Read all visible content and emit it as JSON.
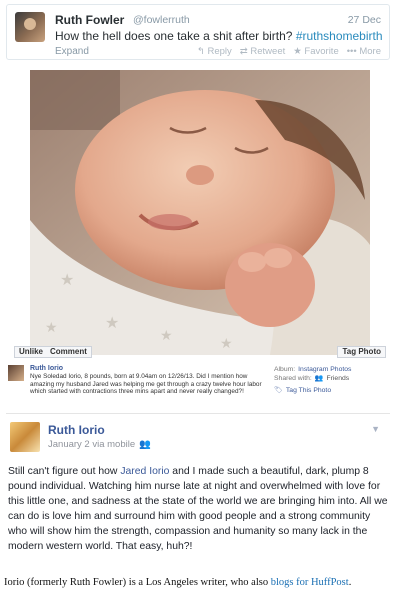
{
  "tweet": {
    "name": "Ruth Fowler",
    "handle": "@fowlerruth",
    "date": "27 Dec",
    "text": "How the hell does one take a shit after birth? ",
    "hashtag": "#ruthshomebirth",
    "expand": "Expand",
    "actions": {
      "reply": "↰ Reply",
      "retweet": "⇄ Retweet",
      "favorite": "★ Favorite",
      "more": "••• More"
    }
  },
  "photo_post": {
    "buttons": {
      "unlike": "Unlike",
      "comment": "Comment",
      "tag": "Tag Photo"
    },
    "author": "Ruth Iorio",
    "caption": "Nye Soledad Iorio, 8 pounds, born at 9.04am on 12/26/13. Did I mention how amazing my husband Jared was helping me get through a crazy twelve hour labor which started with contractions three mins apart and never really changed?!",
    "album_label": "Album:",
    "album": "Instagram Photos",
    "shared_label": "Shared with:",
    "shared_with": "Friends",
    "tag_link": "Tag This Photo"
  },
  "status_post": {
    "name": "Ruth Iorio",
    "meta": "January 2 via mobile",
    "body_1": "Still can't figure out how ",
    "body_link": "Jared Iorio",
    "body_2": " and I made such a beautiful, dark, plump 8 pound individual. Watching him nurse late at night and overwhelmed with love for this little one, and sadness at the state of the world we are bringing him into. All we can do is love him and surround him with good people and a strong community who will show him the strength, compassion and humanity so many lack in the modern western world. That easy, huh?!"
  },
  "footer": {
    "text_1": "Iorio (formerly Ruth Fowler) is a Los Angeles writer, who also ",
    "link": "blogs for HuffPost",
    "text_2": "."
  },
  "colors": {
    "twitter_link": "#2a8bbd",
    "facebook_blue": "#3b5998",
    "footer_link": "#1a6fb3"
  }
}
